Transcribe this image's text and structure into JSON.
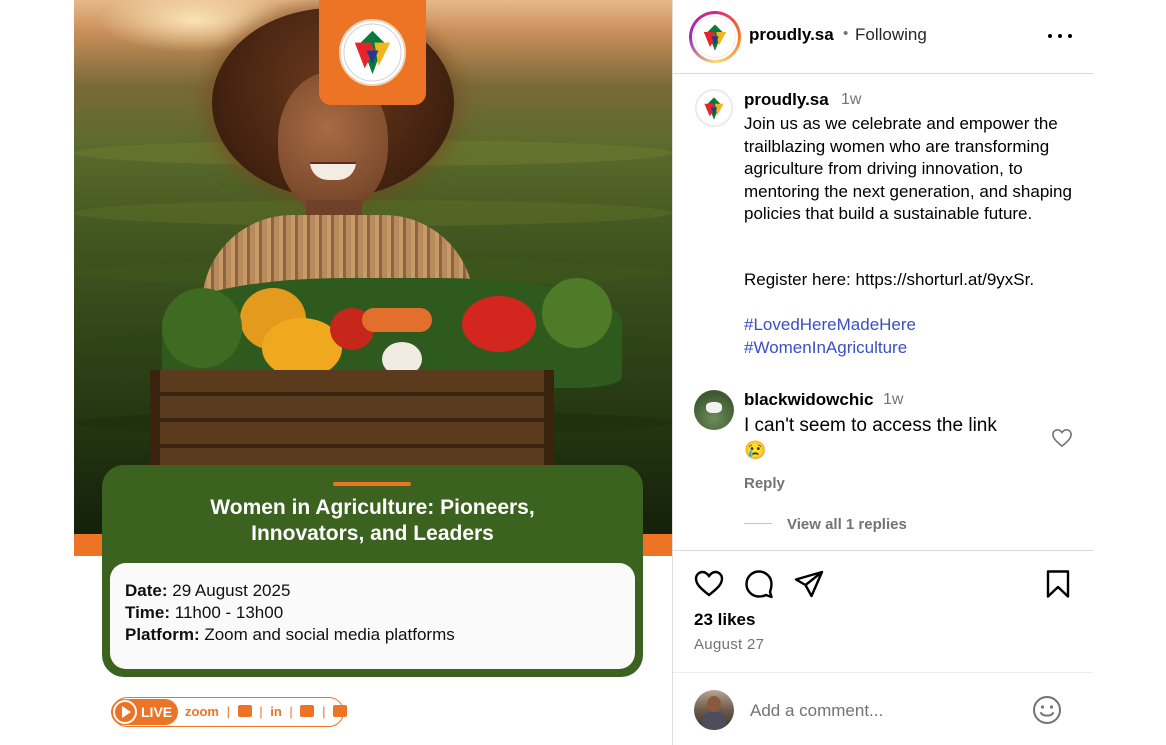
{
  "post": {
    "image": {
      "headline_line1": "Women in Agriculture: Pioneers,",
      "headline_line2": "Innovators, and Leaders",
      "details": [
        {
          "label": "Date:",
          "value": " 29 August 2025"
        },
        {
          "label": "Time:",
          "value": " 11h00 - 13h00"
        },
        {
          "label": "Platform:",
          "value": " Zoom and social media platforms"
        }
      ],
      "live_label": "LIVE",
      "zoom_label": "zoom",
      "social_icons": [
        "youtube-icon",
        "linkedin-icon",
        "facebook-icon",
        "x-icon"
      ],
      "social_in": "in",
      "colors": {
        "orange": "#ec7424",
        "green": "#3c6220"
      }
    }
  },
  "header": {
    "username": "proudly.sa",
    "separator": "•",
    "follow_state": "Following",
    "more_icon": "more-horizontal-icon"
  },
  "caption": {
    "username": "proudly.sa",
    "time": "1w",
    "text": "Join us as we celebrate and empower the trailblazing women who are transforming agriculture from driving innovation, to mentoring the next generation, and shaping policies that build a sustainable future.",
    "register": "Register here: https://shorturl.at/9yxSr.",
    "hashtags": [
      "#LovedHereMadeHere",
      "#WomenInAgriculture"
    ]
  },
  "comment": {
    "username": "blackwidowchic",
    "time": "1w",
    "text": "I can't seem to access the link",
    "emoji": "😢",
    "reply_label": "Reply",
    "view_replies_label": "View all 1 replies"
  },
  "actions": {
    "icons": [
      "heart-icon",
      "comment-icon",
      "share-icon",
      "bookmark-icon"
    ],
    "likes": "23 likes",
    "date": "August 27"
  },
  "add_comment": {
    "placeholder": "Add a comment...",
    "emoji_icon": "emoji-smile-icon"
  }
}
